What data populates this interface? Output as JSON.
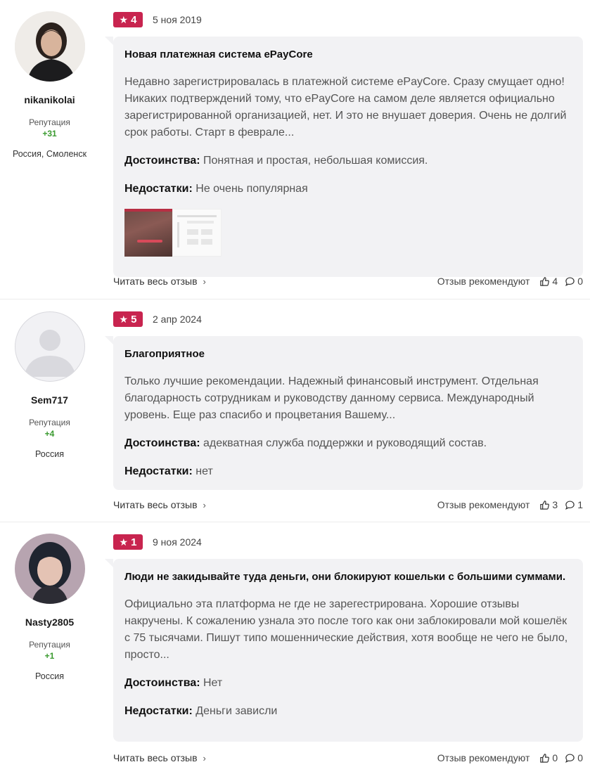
{
  "reviews": [
    {
      "author": {
        "name": "nikanikolai",
        "reputation_label": "Репутация",
        "reputation": "+31",
        "location": "Россия, Смоленск"
      },
      "rating": "4",
      "date": "5 ноя 2019",
      "title": "Новая платежная система ePayCore",
      "text": "Недавно зарегистрировалась в платежной системе ePayCore. Сразу смущает одно! Никаких подтверждений тому, что ePayCore на самом деле является официально зарегистрированной организацией, нет. И это не внушает доверия. Очень не долгий срок работы. Старт в феврале...",
      "pros_label": "Достоинства:",
      "pros": "Понятная и простая, небольшая комиссия.",
      "cons_label": "Недостатки:",
      "cons": "Не очень популярная",
      "read_more": "Читать весь отзыв",
      "recommend_label": "Отзыв рекомендуют",
      "likes": "4",
      "comments": "0"
    },
    {
      "author": {
        "name": "Sem717",
        "reputation_label": "Репутация",
        "reputation": "+4",
        "location": "Россия"
      },
      "rating": "5",
      "date": "2 апр 2024",
      "title": "Благоприятное",
      "text": "Только лучшие рекомендации. Надежный финансовый инструмент. Отдельная благодарность сотрудникам и руководству данному сервиса. Международный уровень. Еще раз спасибо и процветания Вашему...",
      "pros_label": "Достоинства:",
      "pros": "адекватная служба поддержки и руководящий состав.",
      "cons_label": "Недостатки:",
      "cons": "нет",
      "read_more": "Читать весь отзыв",
      "recommend_label": "Отзыв рекомендуют",
      "likes": "3",
      "comments": "1"
    },
    {
      "author": {
        "name": "Nasty2805",
        "reputation_label": "Репутация",
        "reputation": "+1",
        "location": "Россия"
      },
      "rating": "1",
      "date": "9 ноя 2024",
      "title": "Люди не закидывайте туда деньги, они блокируют кошельки с большими суммами.",
      "text": "Официально эта платформа не где не зарегестрирована. Хорошие отзывы накручены. К сожалению узнала это после того как они заблокировали мой кошелёк с 75 тысячами. Пишут типо мошеннические действия, хотя вообще не чего не было, просто...",
      "pros_label": "Достоинства:",
      "pros": "Нет",
      "cons_label": "Недостатки:",
      "cons": "Деньги зависли",
      "read_more": "Читать весь отзыв",
      "recommend_label": "Отзыв рекомендуют",
      "likes": "0",
      "comments": "0"
    }
  ],
  "colors": {
    "badge": "#c8244f",
    "reputation": "#3a9a2f",
    "card": "#f2f2f4"
  },
  "icons": {
    "rating": "star-icon",
    "like": "thumbs-up-icon",
    "comment": "comment-bubble-icon",
    "chevron": "chevron-right-icon"
  }
}
